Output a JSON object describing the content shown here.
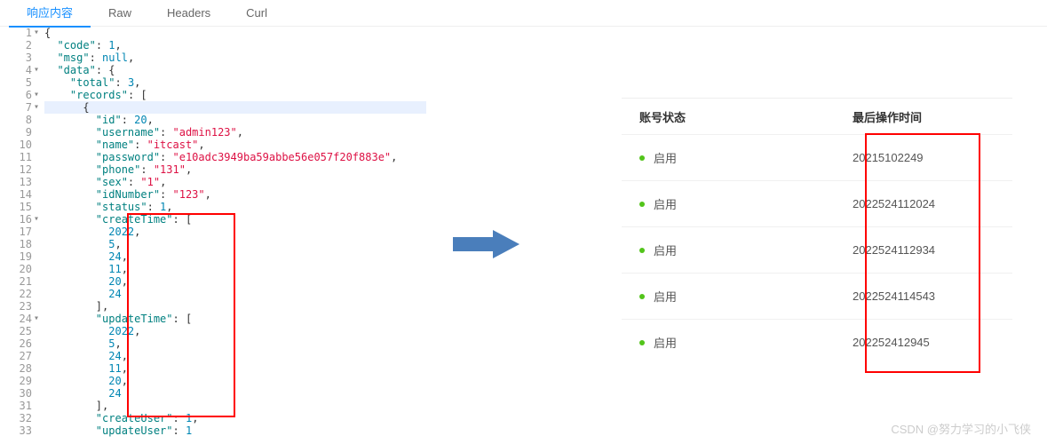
{
  "tabs": {
    "response": "响应内容",
    "raw": "Raw",
    "headers": "Headers",
    "curl": "Curl"
  },
  "code_lines": [
    {
      "n": 1,
      "fold": "v",
      "indent": 0,
      "tokens": [
        {
          "t": "p",
          "v": "{"
        }
      ]
    },
    {
      "n": 2,
      "indent": 1,
      "tokens": [
        {
          "t": "k",
          "v": "\"code\""
        },
        {
          "t": "p",
          "v": ": "
        },
        {
          "t": "n",
          "v": "1"
        },
        {
          "t": "p",
          "v": ","
        }
      ]
    },
    {
      "n": 3,
      "indent": 1,
      "tokens": [
        {
          "t": "k",
          "v": "\"msg\""
        },
        {
          "t": "p",
          "v": ": "
        },
        {
          "t": "b",
          "v": "null"
        },
        {
          "t": "p",
          "v": ","
        }
      ]
    },
    {
      "n": 4,
      "fold": "v",
      "indent": 1,
      "tokens": [
        {
          "t": "k",
          "v": "\"data\""
        },
        {
          "t": "p",
          "v": ": {"
        }
      ]
    },
    {
      "n": 5,
      "indent": 2,
      "tokens": [
        {
          "t": "k",
          "v": "\"total\""
        },
        {
          "t": "p",
          "v": ": "
        },
        {
          "t": "n",
          "v": "3"
        },
        {
          "t": "p",
          "v": ","
        }
      ]
    },
    {
      "n": 6,
      "fold": "v",
      "indent": 2,
      "tokens": [
        {
          "t": "k",
          "v": "\"records\""
        },
        {
          "t": "p",
          "v": ": ["
        }
      ]
    },
    {
      "n": 7,
      "fold": "v",
      "hl": true,
      "indent": 3,
      "tokens": [
        {
          "t": "p",
          "v": "{"
        }
      ]
    },
    {
      "n": 8,
      "indent": 4,
      "tokens": [
        {
          "t": "k",
          "v": "\"id\""
        },
        {
          "t": "p",
          "v": ": "
        },
        {
          "t": "n",
          "v": "20"
        },
        {
          "t": "p",
          "v": ","
        }
      ]
    },
    {
      "n": 9,
      "indent": 4,
      "tokens": [
        {
          "t": "k",
          "v": "\"username\""
        },
        {
          "t": "p",
          "v": ": "
        },
        {
          "t": "s",
          "v": "\"admin123\""
        },
        {
          "t": "p",
          "v": ","
        }
      ]
    },
    {
      "n": 10,
      "indent": 4,
      "tokens": [
        {
          "t": "k",
          "v": "\"name\""
        },
        {
          "t": "p",
          "v": ": "
        },
        {
          "t": "s",
          "v": "\"itcast\""
        },
        {
          "t": "p",
          "v": ","
        }
      ]
    },
    {
      "n": 11,
      "indent": 4,
      "tokens": [
        {
          "t": "k",
          "v": "\"password\""
        },
        {
          "t": "p",
          "v": ": "
        },
        {
          "t": "s",
          "v": "\"e10adc3949ba59abbe56e057f20f883e\""
        },
        {
          "t": "p",
          "v": ","
        }
      ]
    },
    {
      "n": 12,
      "indent": 4,
      "tokens": [
        {
          "t": "k",
          "v": "\"phone\""
        },
        {
          "t": "p",
          "v": ": "
        },
        {
          "t": "s",
          "v": "\"131\""
        },
        {
          "t": "p",
          "v": ","
        }
      ]
    },
    {
      "n": 13,
      "indent": 4,
      "tokens": [
        {
          "t": "k",
          "v": "\"sex\""
        },
        {
          "t": "p",
          "v": ": "
        },
        {
          "t": "s",
          "v": "\"1\""
        },
        {
          "t": "p",
          "v": ","
        }
      ]
    },
    {
      "n": 14,
      "indent": 4,
      "tokens": [
        {
          "t": "k",
          "v": "\"idNumber\""
        },
        {
          "t": "p",
          "v": ": "
        },
        {
          "t": "s",
          "v": "\"123\""
        },
        {
          "t": "p",
          "v": ","
        }
      ]
    },
    {
      "n": 15,
      "indent": 4,
      "tokens": [
        {
          "t": "k",
          "v": "\"status\""
        },
        {
          "t": "p",
          "v": ": "
        },
        {
          "t": "n",
          "v": "1"
        },
        {
          "t": "p",
          "v": ","
        }
      ]
    },
    {
      "n": 16,
      "fold": "v",
      "indent": 4,
      "tokens": [
        {
          "t": "k",
          "v": "\"createTime\""
        },
        {
          "t": "p",
          "v": ": ["
        }
      ]
    },
    {
      "n": 17,
      "indent": 5,
      "tokens": [
        {
          "t": "n",
          "v": "2022"
        },
        {
          "t": "p",
          "v": ","
        }
      ]
    },
    {
      "n": 18,
      "indent": 5,
      "tokens": [
        {
          "t": "n",
          "v": "5"
        },
        {
          "t": "p",
          "v": ","
        }
      ]
    },
    {
      "n": 19,
      "indent": 5,
      "tokens": [
        {
          "t": "n",
          "v": "24"
        },
        {
          "t": "p",
          "v": ","
        }
      ]
    },
    {
      "n": 20,
      "indent": 5,
      "tokens": [
        {
          "t": "n",
          "v": "11"
        },
        {
          "t": "p",
          "v": ","
        }
      ]
    },
    {
      "n": 21,
      "indent": 5,
      "tokens": [
        {
          "t": "n",
          "v": "20"
        },
        {
          "t": "p",
          "v": ","
        }
      ]
    },
    {
      "n": 22,
      "indent": 5,
      "tokens": [
        {
          "t": "n",
          "v": "24"
        }
      ]
    },
    {
      "n": 23,
      "indent": 4,
      "tokens": [
        {
          "t": "p",
          "v": "],"
        }
      ]
    },
    {
      "n": 24,
      "fold": "v",
      "indent": 4,
      "tokens": [
        {
          "t": "k",
          "v": "\"updateTime\""
        },
        {
          "t": "p",
          "v": ": ["
        }
      ]
    },
    {
      "n": 25,
      "indent": 5,
      "tokens": [
        {
          "t": "n",
          "v": "2022"
        },
        {
          "t": "p",
          "v": ","
        }
      ]
    },
    {
      "n": 26,
      "indent": 5,
      "tokens": [
        {
          "t": "n",
          "v": "5"
        },
        {
          "t": "p",
          "v": ","
        }
      ]
    },
    {
      "n": 27,
      "indent": 5,
      "tokens": [
        {
          "t": "n",
          "v": "24"
        },
        {
          "t": "p",
          "v": ","
        }
      ]
    },
    {
      "n": 28,
      "indent": 5,
      "tokens": [
        {
          "t": "n",
          "v": "11"
        },
        {
          "t": "p",
          "v": ","
        }
      ]
    },
    {
      "n": 29,
      "indent": 5,
      "tokens": [
        {
          "t": "n",
          "v": "20"
        },
        {
          "t": "p",
          "v": ","
        }
      ]
    },
    {
      "n": 30,
      "indent": 5,
      "tokens": [
        {
          "t": "n",
          "v": "24"
        }
      ]
    },
    {
      "n": 31,
      "indent": 4,
      "tokens": [
        {
          "t": "p",
          "v": "],"
        }
      ]
    },
    {
      "n": 32,
      "indent": 4,
      "tokens": [
        {
          "t": "k",
          "v": "\"createUser\""
        },
        {
          "t": "p",
          "v": ": "
        },
        {
          "t": "n",
          "v": "1"
        },
        {
          "t": "p",
          "v": ","
        }
      ]
    },
    {
      "n": 33,
      "indent": 4,
      "tokens": [
        {
          "t": "k",
          "v": "\"updateUser\""
        },
        {
          "t": "p",
          "v": ": "
        },
        {
          "t": "n",
          "v": "1"
        }
      ]
    }
  ],
  "table": {
    "header_status": "账号状态",
    "header_time": "最后操作时间",
    "rows": [
      {
        "status": "启用",
        "time": "20215102249"
      },
      {
        "status": "启用",
        "time": "2022524112024"
      },
      {
        "status": "启用",
        "time": "2022524112934"
      },
      {
        "status": "启用",
        "time": "2022524114543"
      },
      {
        "status": "启用",
        "time": "202252412945"
      }
    ]
  },
  "watermark": "CSDN @努力学习的小飞侠"
}
